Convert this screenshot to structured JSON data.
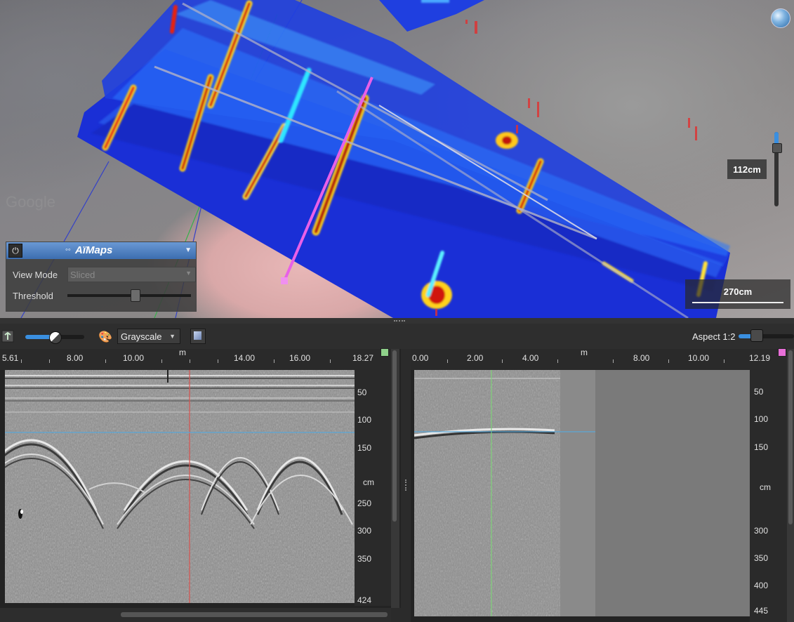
{
  "map": {
    "depth_readout": "112cm",
    "scale_label": "270cm",
    "watermark": "Google",
    "globe_icon": "globe-icon"
  },
  "panel": {
    "brand": "AïMaps",
    "view_mode_label": "View Mode",
    "view_mode_value": "Sliced",
    "threshold_label": "Threshold",
    "threshold_value": 0.55
  },
  "toolbar": {
    "colormap_value": "Grayscale",
    "gain_value": 0.5,
    "aspect_label": "Aspect 1:2"
  },
  "left_view": {
    "x_ticks": [
      "5.61",
      "8.00",
      "10.00",
      "14.00",
      "16.00",
      "18.27"
    ],
    "x_unit": "m",
    "depth_ticks": [
      "50",
      "100",
      "150",
      "250",
      "300",
      "350",
      "424"
    ],
    "depth_unit": "cm",
    "marker_color": "#8fd18a",
    "cursor_color": "#d9534f",
    "horizon_color": "#5aa6d6"
  },
  "right_view": {
    "x_ticks": [
      "0.00",
      "2.00",
      "4.00",
      "8.00",
      "10.00",
      "12.19"
    ],
    "x_unit": "m",
    "depth_ticks": [
      "50",
      "100",
      "150",
      "300",
      "350",
      "400",
      "445"
    ],
    "depth_unit": "cm",
    "marker_color": "#e86fd8",
    "cursor_color": "#7fd17a",
    "horizon_color": "#5aa6d6"
  }
}
